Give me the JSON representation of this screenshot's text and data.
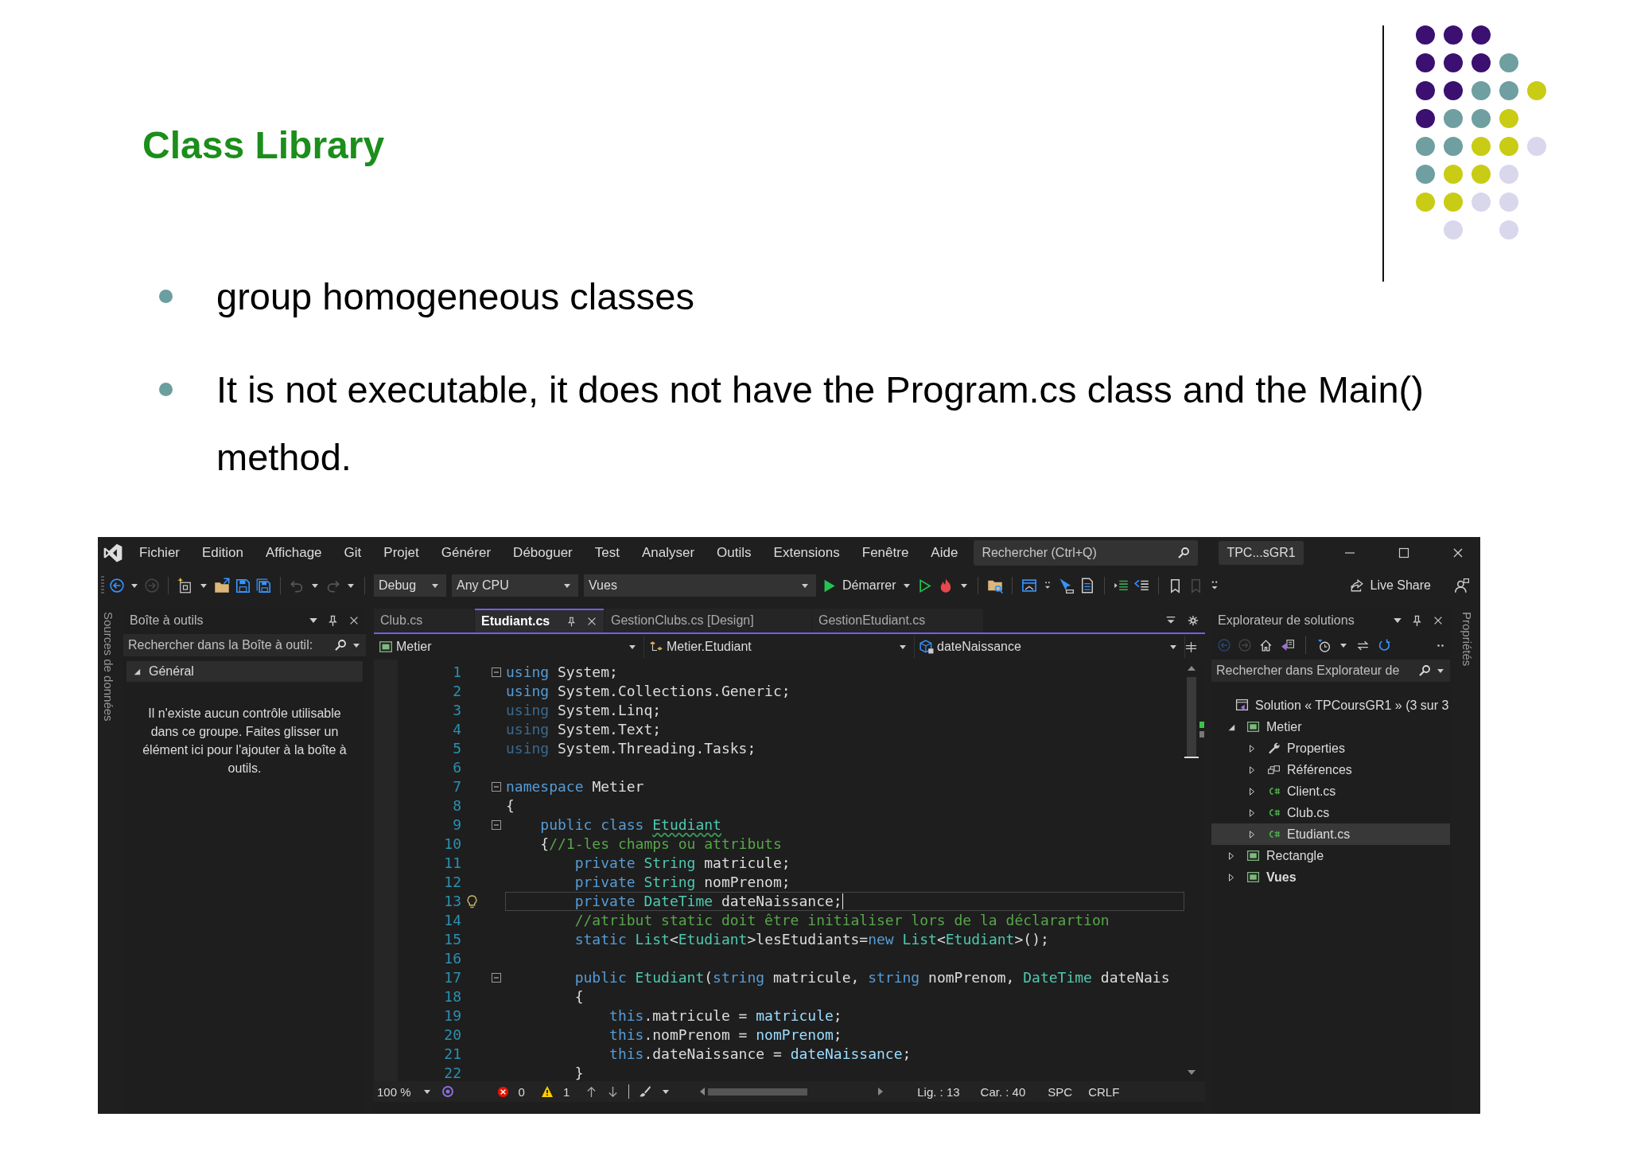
{
  "slide": {
    "title": "Class Library",
    "bullets": [
      "group homogeneous classes",
      "It is not executable, it does not have the Program.cs class and the Main() method."
    ],
    "dot_rows": [
      [
        {
          "color": "#3b1070"
        },
        {
          "color": "#3b1070"
        },
        {
          "color": "#3b1070"
        },
        null,
        null
      ],
      [
        {
          "color": "#3b1070"
        },
        {
          "color": "#3b1070"
        },
        {
          "color": "#3b1070"
        },
        {
          "color": "#6f9fa0"
        },
        null
      ],
      [
        {
          "color": "#3b1070"
        },
        {
          "color": "#3b1070"
        },
        {
          "color": "#6f9fa0"
        },
        {
          "color": "#6f9fa0"
        },
        {
          "color": "#c9cc14"
        }
      ],
      [
        {
          "color": "#3b1070"
        },
        {
          "color": "#6f9fa0"
        },
        {
          "color": "#6f9fa0"
        },
        {
          "color": "#c9cc14"
        },
        null
      ],
      [
        {
          "color": "#6f9fa0"
        },
        {
          "color": "#6f9fa0"
        },
        {
          "color": "#c9cc14"
        },
        {
          "color": "#c9cc14"
        },
        {
          "color": "#d9d7ec"
        }
      ],
      [
        {
          "color": "#6f9fa0"
        },
        {
          "color": "#c9cc14"
        },
        {
          "color": "#c9cc14"
        },
        {
          "color": "#d9d7ec"
        },
        null
      ],
      [
        {
          "color": "#c9cc14"
        },
        {
          "color": "#c9cc14"
        },
        {
          "color": "#d9d7ec"
        },
        {
          "color": "#d9d7ec"
        },
        null
      ],
      [
        null,
        {
          "color": "#d9d7ec"
        },
        null,
        {
          "color": "#d9d7ec"
        },
        null
      ]
    ]
  },
  "ide": {
    "menu": [
      "Fichier",
      "Edition",
      "Affichage",
      "Git",
      "Projet",
      "Générer",
      "Déboguer",
      "Test",
      "Analyser",
      "Outils",
      "Extensions",
      "Fenêtre",
      "Aide"
    ],
    "search": {
      "placeholder": "Rechercher (Ctrl+Q)"
    },
    "solution_name": "TPC...sGR1",
    "toolbar": {
      "configuration": "Debug",
      "platform": "Any CPU",
      "startup_project": "Vues",
      "start": "Démarrer",
      "live_share": "Live Share"
    },
    "left_strip": "Sources de données",
    "right_strip": "Propriétés",
    "toolbox": {
      "title": "Boîte à outils",
      "search": {
        "placeholder": "Rechercher dans la Boîte à outil:"
      },
      "group": {
        "label": "Général",
        "expanded": true
      },
      "message": "Il n'existe aucun contrôle utilisable dans ce groupe. Faites glisser un élément ici pour l'ajouter à la boîte à outils."
    },
    "editor": {
      "tabs": [
        {
          "label": "Club.cs",
          "selected": false
        },
        {
          "label": "Etudiant.cs",
          "selected": true
        },
        {
          "label": "GestionClubs.cs [Design]",
          "selected": false
        },
        {
          "label": "GestionEtudiant.cs",
          "selected": false
        }
      ],
      "nav": [
        {
          "label": "Metier",
          "kind": "project"
        },
        {
          "label": "Metier.Etudiant",
          "kind": "class"
        },
        {
          "label": "dateNaissance",
          "kind": "field"
        }
      ],
      "lines": [
        {
          "number": "1",
          "fold": true,
          "lightbulb": false,
          "current": false,
          "tokens": [
            {
              "kind": "kw",
              "text": "using"
            },
            {
              "kind": "p",
              "text": " System;"
            }
          ]
        },
        {
          "number": "2",
          "fold": false,
          "lightbulb": false,
          "current": false,
          "tokens": [
            {
              "kind": "kw",
              "text": "using"
            },
            {
              "kind": "p",
              "text": " System.Collections.Generic;"
            }
          ]
        },
        {
          "number": "3",
          "fold": false,
          "lightbulb": false,
          "current": false,
          "tokens": [
            {
              "kind": "dim",
              "text": "using"
            },
            {
              "kind": "p",
              "text": " System.Linq;"
            }
          ]
        },
        {
          "number": "4",
          "fold": false,
          "lightbulb": false,
          "current": false,
          "tokens": [
            {
              "kind": "dim",
              "text": "using"
            },
            {
              "kind": "p",
              "text": " System.Text;"
            }
          ]
        },
        {
          "number": "5",
          "fold": false,
          "lightbulb": false,
          "current": false,
          "tokens": [
            {
              "kind": "dim",
              "text": "using"
            },
            {
              "kind": "p",
              "text": " System.Threading.Tasks;"
            }
          ]
        },
        {
          "number": "6",
          "fold": false,
          "lightbulb": false,
          "current": false
        },
        {
          "number": "7",
          "fold": true,
          "lightbulb": false,
          "current": false,
          "tokens": [
            {
              "kind": "kw",
              "text": "namespace"
            },
            {
              "kind": "p",
              "text": " Metier"
            }
          ]
        },
        {
          "number": "8",
          "fold": false,
          "lightbulb": false,
          "current": false,
          "tokens": [
            {
              "kind": "p",
              "text": "{"
            }
          ]
        },
        {
          "number": "9",
          "fold": true,
          "lightbulb": false,
          "current": false,
          "tokens": [
            {
              "kind": "kw",
              "text": "    public class "
            },
            {
              "kind": "warn",
              "text": "Etudiant"
            }
          ]
        },
        {
          "number": "10",
          "fold": false,
          "lightbulb": false,
          "current": false,
          "tokens": [
            {
              "kind": "p",
              "text": "    {"
            },
            {
              "kind": "com",
              "text": "//1-les champs ou attributs"
            }
          ]
        },
        {
          "number": "11",
          "fold": false,
          "lightbulb": false,
          "current": false,
          "tokens": [
            {
              "kind": "kw",
              "text": "        private "
            },
            {
              "kind": "type",
              "text": "String"
            },
            {
              "kind": "p",
              "text": " matricule;"
            }
          ]
        },
        {
          "number": "12",
          "fold": false,
          "lightbulb": false,
          "current": false,
          "tokens": [
            {
              "kind": "kw",
              "text": "        private "
            },
            {
              "kind": "type",
              "text": "String"
            },
            {
              "kind": "p",
              "text": " nomPrenom;"
            }
          ]
        },
        {
          "number": "13",
          "fold": false,
          "lightbulb": true,
          "current": true,
          "tokens": [
            {
              "kind": "kw",
              "text": "        private "
            },
            {
              "kind": "type",
              "text": "DateTime"
            },
            {
              "kind": "p",
              "text": " dateNaissance;"
            }
          ]
        },
        {
          "number": "14",
          "fold": false,
          "lightbulb": false,
          "current": false,
          "tokens": [
            {
              "kind": "com",
              "text": "        //atribut static doit être initialiser lors de la déclarartion"
            }
          ]
        },
        {
          "number": "15",
          "fold": false,
          "lightbulb": false,
          "current": false,
          "tokens": [
            {
              "kind": "kw",
              "text": "        static "
            },
            {
              "kind": "type",
              "text": "List"
            },
            {
              "kind": "p",
              "text": "<"
            },
            {
              "kind": "type",
              "text": "Etudiant"
            },
            {
              "kind": "p",
              "text": ">lesEtudiants="
            },
            {
              "kind": "kw",
              "text": "new "
            },
            {
              "kind": "type",
              "text": "List"
            },
            {
              "kind": "p",
              "text": "<"
            },
            {
              "kind": "type",
              "text": "Etudiant"
            },
            {
              "kind": "p",
              "text": ">();"
            }
          ]
        },
        {
          "number": "16",
          "fold": false,
          "lightbulb": false,
          "current": false
        },
        {
          "number": "17",
          "fold": true,
          "lightbulb": false,
          "current": false,
          "tokens": [
            {
              "kind": "kw",
              "text": "        public "
            },
            {
              "kind": "type",
              "text": "Etudiant"
            },
            {
              "kind": "p",
              "text": "("
            },
            {
              "kind": "kw",
              "text": "string"
            },
            {
              "kind": "p",
              "text": " matricule, "
            },
            {
              "kind": "kw",
              "text": "string"
            },
            {
              "kind": "p",
              "text": " nomPrenom, "
            },
            {
              "kind": "type",
              "text": "DateTime"
            },
            {
              "kind": "p",
              "text": " dateNais"
            }
          ]
        },
        {
          "number": "18",
          "fold": false,
          "lightbulb": false,
          "current": false,
          "tokens": [
            {
              "kind": "p",
              "text": "        {"
            }
          ]
        },
        {
          "number": "19",
          "fold": false,
          "lightbulb": false,
          "current": false,
          "tokens": [
            {
              "kind": "kw",
              "text": "            this"
            },
            {
              "kind": "p",
              "text": ".matricule = "
            },
            {
              "kind": "id",
              "text": "matricule"
            },
            {
              "kind": "p",
              "text": ";"
            }
          ]
        },
        {
          "number": "20",
          "fold": false,
          "lightbulb": false,
          "current": false,
          "tokens": [
            {
              "kind": "kw",
              "text": "            this"
            },
            {
              "kind": "p",
              "text": ".nomPrenom = "
            },
            {
              "kind": "id",
              "text": "nomPrenom"
            },
            {
              "kind": "p",
              "text": ";"
            }
          ]
        },
        {
          "number": "21",
          "fold": false,
          "lightbulb": false,
          "current": false,
          "tokens": [
            {
              "kind": "kw",
              "text": "            this"
            },
            {
              "kind": "p",
              "text": ".dateNaissance = "
            },
            {
              "kind": "id",
              "text": "dateNaissance"
            },
            {
              "kind": "p",
              "text": ";"
            }
          ]
        },
        {
          "number": "22",
          "fold": false,
          "lightbulb": false,
          "current": false,
          "tokens": [
            {
              "kind": "p",
              "text": "        }"
            }
          ]
        }
      ],
      "status": {
        "zoom": "100 %",
        "errors": "0",
        "warnings": "1",
        "line": "Lig. : 13",
        "column": "Car. : 40",
        "whitespace": "SPC",
        "line_ending": "CRLF"
      }
    },
    "solution_explorer": {
      "title": "Explorateur de solutions",
      "search": {
        "placeholder": "Rechercher dans Explorateur de"
      },
      "tree": [
        {
          "label": "Solution « TPCoursGR1 » (3 sur 3",
          "kind": "solution",
          "selected": false,
          "children": [
            {
              "label": "Metier",
              "kind": "project",
              "expanded": true,
              "selected": false,
              "startup": false,
              "children": [
                {
                  "label": "Properties",
                  "kind": "properties",
                  "expanded": false,
                  "selected": false
                },
                {
                  "label": "Références",
                  "kind": "references",
                  "expanded": false,
                  "selected": false
                },
                {
                  "label": "Client.cs",
                  "kind": "csfile",
                  "expanded": false,
                  "selected": false
                },
                {
                  "label": "Club.cs",
                  "kind": "csfile",
                  "expanded": false,
                  "selected": false
                },
                {
                  "label": "Etudiant.cs",
                  "kind": "csfile",
                  "expanded": false,
                  "selected": true
                }
              ]
            },
            {
              "label": "Rectangle",
              "kind": "project",
              "expanded": false,
              "selected": false,
              "startup": false
            },
            {
              "label": "Vues",
              "kind": "project",
              "expanded": false,
              "selected": false,
              "startup": true
            }
          ]
        }
      ]
    }
  }
}
